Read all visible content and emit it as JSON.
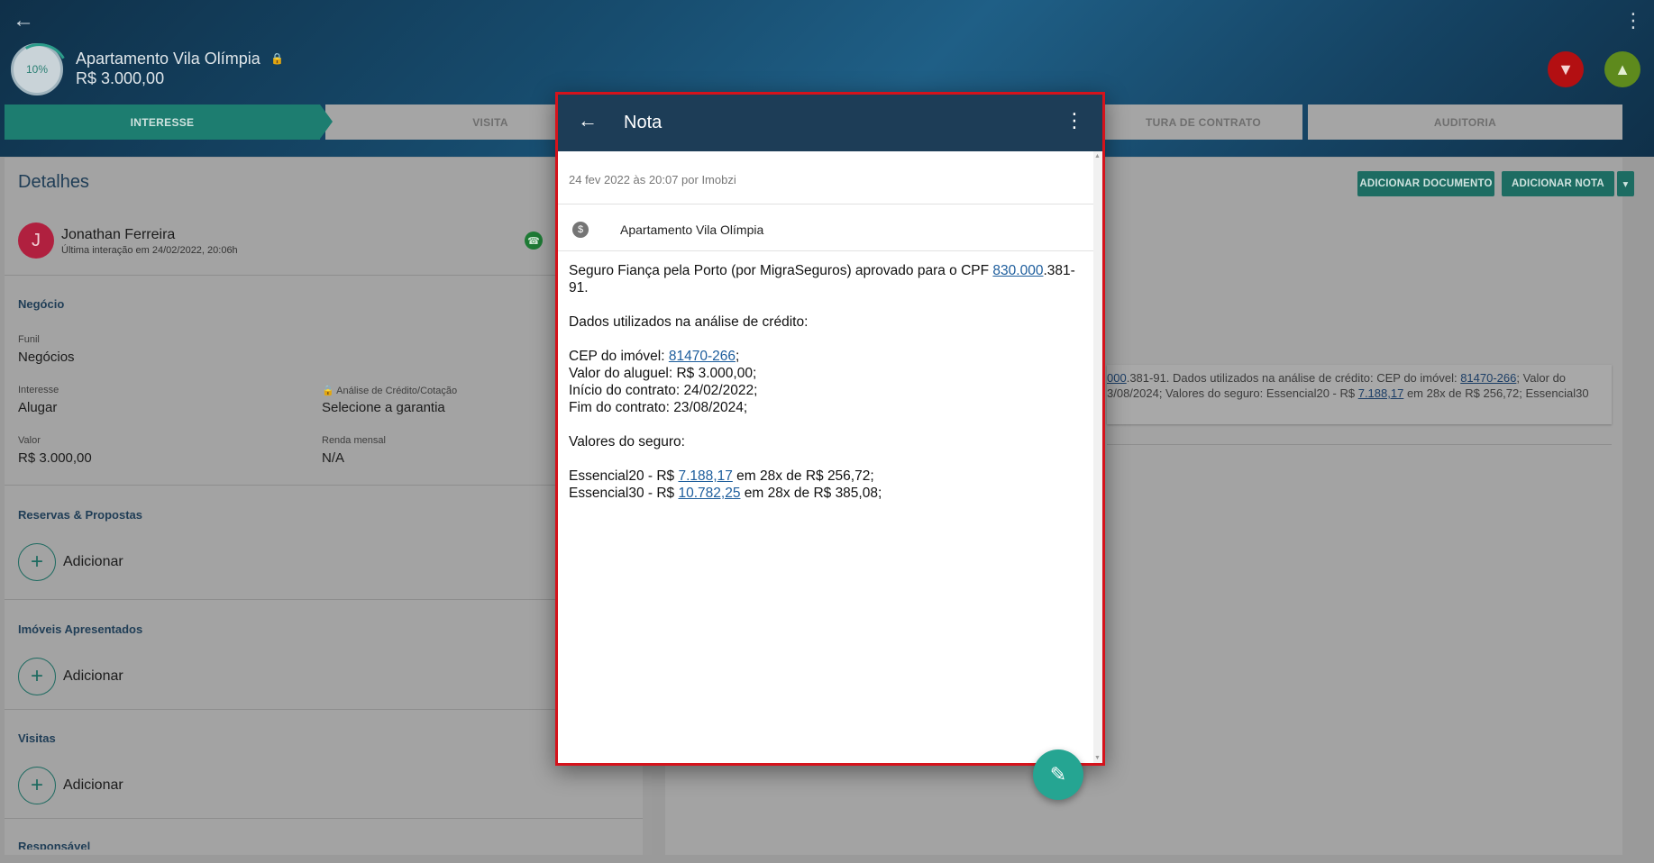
{
  "header": {
    "title": "Apartamento Vila Olímpia",
    "price": "R$ 3.000,00",
    "progress": "10%",
    "icons": {
      "back": "arrow-left-icon",
      "menu": "kebab-icon",
      "lock": "lock-icon",
      "like": "thumbs-up-icon",
      "dislike": "thumbs-down-icon"
    }
  },
  "stepper": {
    "steps": [
      "INTERESSE",
      "VISITA",
      "TURA DE CONTRATO",
      "AUDITORIA"
    ],
    "active_index": 0
  },
  "details": {
    "title": "Detalhes",
    "contact": {
      "initial": "J",
      "name": "Jonathan Ferreira",
      "last_interaction": "Última interação em 24/02/2022, 20:06h"
    },
    "negocio": {
      "section": "Negócio",
      "funil_label": "Funil",
      "funil_value": "Negócios",
      "interesse_label": "Interesse",
      "interesse_value": "Alugar",
      "analise_label": "Análise de Crédito/Cotação",
      "analise_value": "Selecione a garantia",
      "valor_label": "Valor",
      "valor_value": "R$ 3.000,00",
      "renda_label": "Renda mensal",
      "renda_value": "N/A"
    },
    "reservas": {
      "section": "Reservas & Propostas",
      "add_label": "Adicionar"
    },
    "imoveis": {
      "section": "Imóveis Apresentados",
      "add_label": "Adicionar"
    },
    "visitas": {
      "section": "Visitas",
      "add_label": "Adicionar"
    },
    "responsavel": {
      "section": "Responsável"
    }
  },
  "right": {
    "add_document": "ADICIONAR DOCUMENTO",
    "add_note": "ADICIONAR NOTA",
    "note_preview": {
      "link1": "000",
      "part1": ".381-91. Dados utilizados na análise de crédito: CEP do imóvel: ",
      "link2": "81470-266",
      "part2": "; Valor do",
      "part3": "3/08/2024; Valores do seguro: Essencial20 - R$ ",
      "link3": "7.188,17",
      "part4": " em 28x de R$ 256,72; Essencial30"
    }
  },
  "modal": {
    "title": "Nota",
    "meta": "24 fev 2022 às 20:07 por Imobzi",
    "property": "Apartamento Vila Olímpia",
    "body": {
      "l1_pre": "Seguro Fiança pela Porto (por MigraSeguros) aprovado para o CPF ",
      "l1_link": "830.000",
      "l1_post": ".381-",
      "l2": "91.",
      "l3": "Dados utilizados na análise de crédito:",
      "l4_pre": "CEP do imóvel: ",
      "l4_link": "81470-266",
      "l4_post": ";",
      "l5": "Valor do aluguel: R$ 3.000,00;",
      "l6": "Início do contrato: 24/02/2022;",
      "l7": "Fim do contrato: 23/08/2024;",
      "l8": "Valores do seguro:",
      "l9_pre": "Essencial20 - R$ ",
      "l9_link": "7.188,17",
      "l9_post": " em 28x de R$ 256,72;",
      "l10_pre": "Essencial30 - R$ ",
      "l10_link": "10.782,25",
      "l10_post": " em 28x de R$ 385,08;"
    }
  },
  "colors": {
    "primary": "#1d3d57",
    "accent": "#25a592",
    "highlight_border": "#d5131c",
    "link": "#1d5d9c"
  }
}
